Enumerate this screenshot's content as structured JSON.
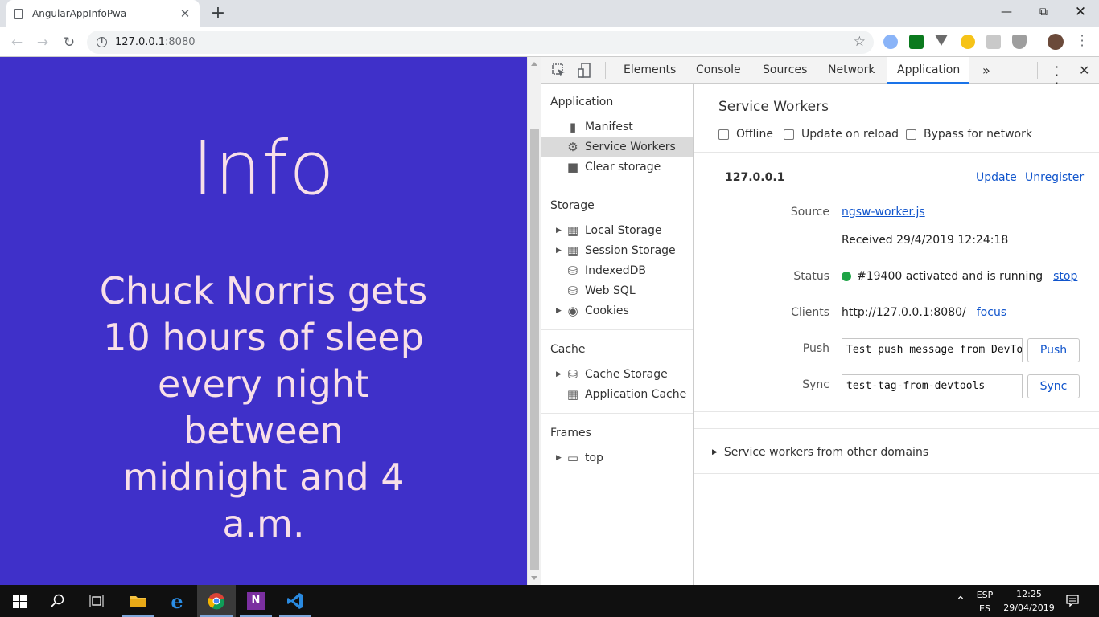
{
  "browser": {
    "tab_title": "AngularAppInfoPwa",
    "url_host": "127.0.0.1",
    "url_port": ":8080"
  },
  "page": {
    "heading": "Info",
    "quote_lines": [
      "Chuck Norris gets",
      "10 hours of sleep",
      "every night",
      "between",
      "midnight and 4",
      "a.m."
    ],
    "background": "#3f30c9"
  },
  "devtools": {
    "tabs": [
      "Elements",
      "Console",
      "Sources",
      "Network",
      "Application"
    ],
    "active_tab": "Application",
    "sidebar": {
      "application_title": "Application",
      "application_items": [
        "Manifest",
        "Service Workers",
        "Clear storage"
      ],
      "selected_item": "Service Workers",
      "storage_title": "Storage",
      "storage_items": [
        "Local Storage",
        "Session Storage",
        "IndexedDB",
        "Web SQL",
        "Cookies"
      ],
      "cache_title": "Cache",
      "cache_items": [
        "Cache Storage",
        "Application Cache"
      ],
      "frames_title": "Frames",
      "frames_items": [
        "top"
      ]
    },
    "service_workers": {
      "title": "Service Workers",
      "options": [
        "Offline",
        "Update on reload",
        "Bypass for network"
      ],
      "origin": "127.0.0.1",
      "update_link": "Update",
      "unregister_link": "Unregister",
      "source_label": "Source",
      "source_file": "ngsw-worker.js",
      "received": "Received 29/4/2019 12:24:18",
      "status_label": "Status",
      "status_text": "#19400 activated and is running",
      "stop_link": "stop",
      "status_color": "#1ea446",
      "clients_label": "Clients",
      "client_url": "http://127.0.0.1:8080/",
      "focus_link": "focus",
      "push_label": "Push",
      "push_value": "Test push message from DevTools.",
      "push_button": "Push",
      "sync_label": "Sync",
      "sync_value": "test-tag-from-devtools",
      "sync_button": "Sync",
      "other_domains": "Service workers from other domains"
    }
  },
  "taskbar": {
    "lang_top": "ESP",
    "lang_bottom": "ES",
    "time": "12:25",
    "date": "29/04/2019"
  }
}
